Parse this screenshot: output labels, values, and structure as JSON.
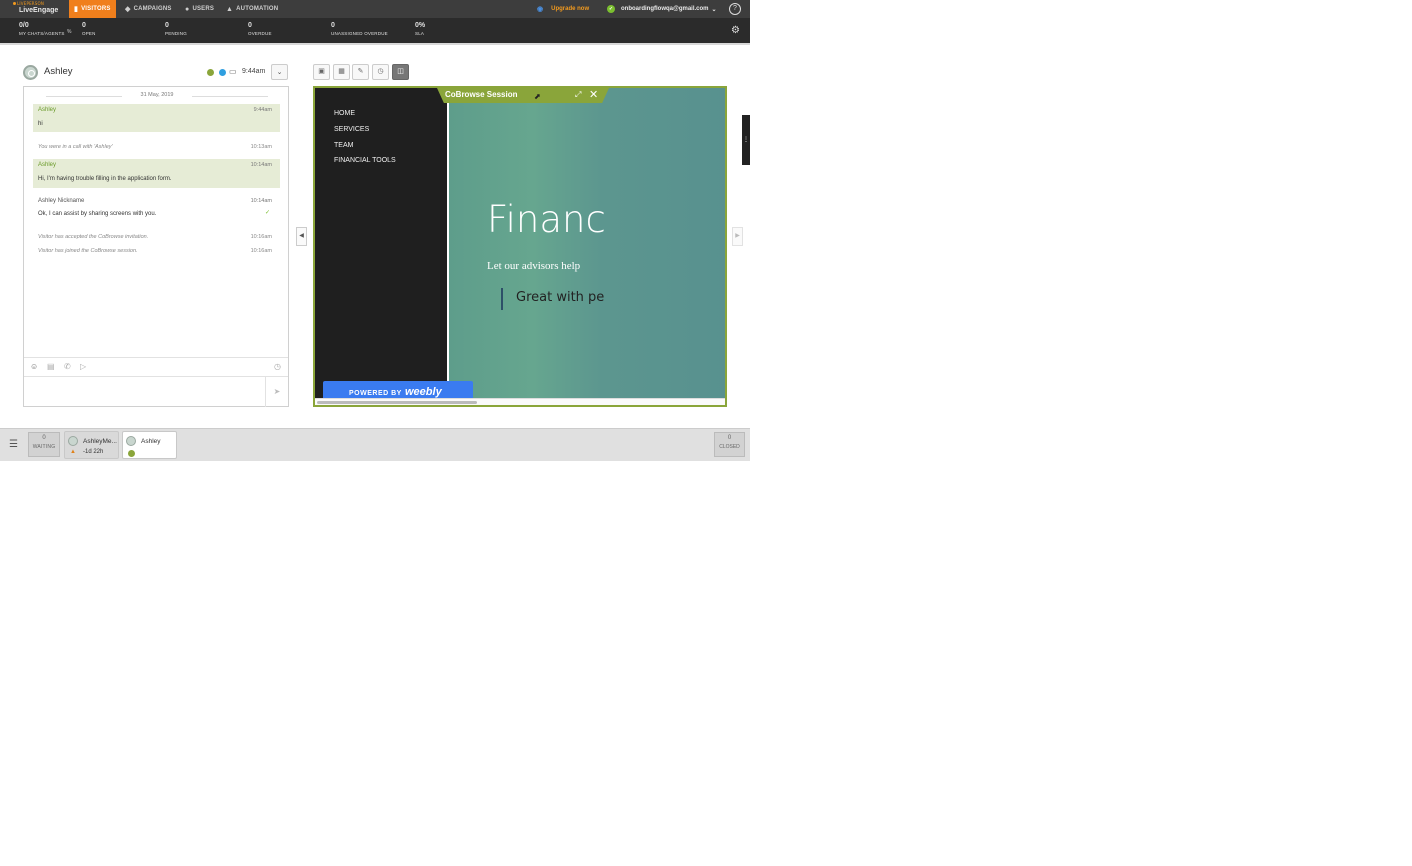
{
  "brand": {
    "sub": "LIVEPERSON",
    "name": "LiveEngage"
  },
  "nav": {
    "tabs": [
      {
        "label": "VISITORS",
        "icon": "chat-bubble-icon"
      },
      {
        "label": "CAMPAIGNS",
        "icon": "tag-icon"
      },
      {
        "label": "USERS",
        "icon": "user-icon"
      },
      {
        "label": "AUTOMATION",
        "icon": "robot-icon"
      }
    ],
    "upgrade_label": "Upgrade now",
    "account_email": "onboardingflowqa@gmail.com",
    "help": "?"
  },
  "stats": [
    {
      "num": "0/0",
      "label": "MY CHATS/AGENTS"
    },
    {
      "num": "0",
      "label": "OPEN"
    },
    {
      "num": "0",
      "label": "PENDING"
    },
    {
      "num": "0",
      "label": "OVERDUE"
    },
    {
      "num": "0",
      "label": "UNASSIGNED OVERDUE"
    },
    {
      "num": "0%",
      "label": "SLA"
    }
  ],
  "stat_pct": "%",
  "visitor": {
    "name": "Ashley",
    "time": "9:44am"
  },
  "conversation": {
    "date": "31 May, 2019",
    "messages": [
      {
        "type": "visitor",
        "who": "Ashley",
        "time": "9:44am",
        "text": "hi"
      },
      {
        "type": "system",
        "text": "You were in a call with 'Ashley'",
        "time": "10:13am"
      },
      {
        "type": "visitor",
        "who": "Ashley",
        "time": "10:14am",
        "text": "Hi, I'm having trouble filling in the application form."
      },
      {
        "type": "agent",
        "who": "Ashley Nickname",
        "time": "10:14am",
        "text": "Ok, I can assist by sharing screens with you."
      },
      {
        "type": "system",
        "text": "Visitor has accepted the CoBrowse invitation.",
        "time": "10:16am"
      },
      {
        "type": "system",
        "text": "Visitor has joined the CoBrowse session.",
        "time": "10:16am"
      }
    ]
  },
  "cobrowse": {
    "title": "CoBrowse Session",
    "site_nav": [
      "HOME",
      "SERVICES",
      "TEAM",
      "FINANCIAL TOOLS"
    ],
    "hero_title": "Financ",
    "hero_sub": "Let our advisors help",
    "hero_quote": "Great with pe",
    "powered_by": "POWERED BY",
    "powered_logo": "weebly"
  },
  "bottom": {
    "waiting": {
      "num": "0",
      "label": "WAITING"
    },
    "tabs": [
      {
        "name": "AshleyMe...",
        "sub": "-1d 22h"
      },
      {
        "name": "Ashley",
        "sub": ""
      }
    ],
    "closed": {
      "num": "0",
      "label": "CLOSED"
    }
  },
  "colors": {
    "accent": "#f07f1c",
    "cobrowse": "#8aa53a",
    "visitor_bubble": "#e6ecd6"
  }
}
